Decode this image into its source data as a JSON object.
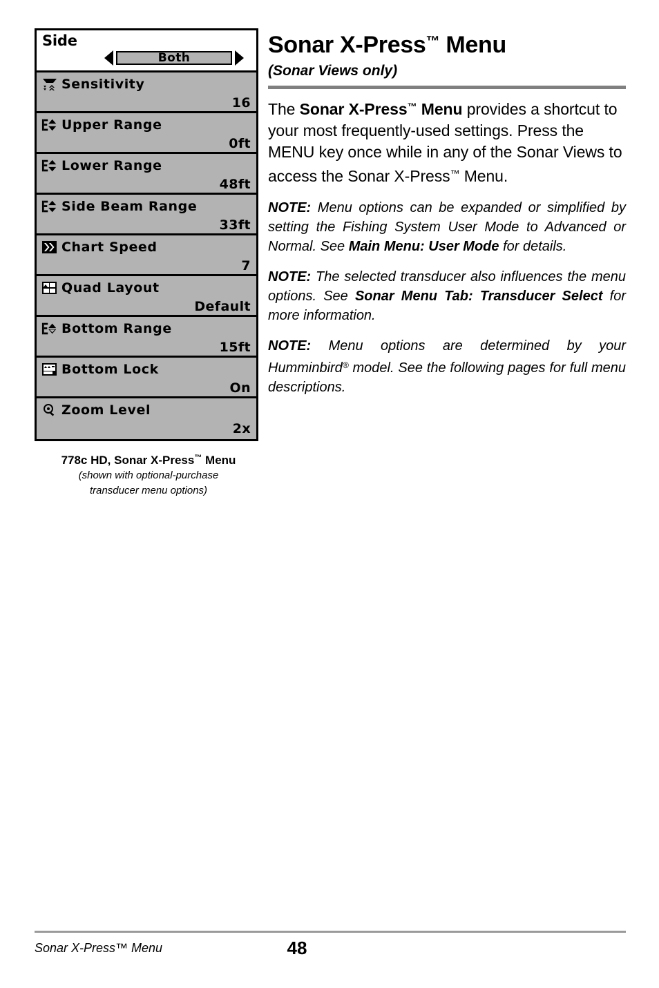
{
  "document": {
    "page_number": "48",
    "footer_left": "Sonar X-Press™ Menu"
  },
  "figure": {
    "device_menu": {
      "header": {
        "title": "Side",
        "selected_value": "Both",
        "left_arrow": "◀",
        "right_arrow": "▶"
      },
      "rows": [
        {
          "icon": "sensitivity-icon",
          "label": "Sensitivity",
          "value": "16"
        },
        {
          "icon": "upper-range-icon",
          "label": "Upper Range",
          "value": "0ft"
        },
        {
          "icon": "lower-range-icon",
          "label": "Lower Range",
          "value": "48ft"
        },
        {
          "icon": "side-beam-range-icon",
          "label": "Side Beam Range",
          "value": "33ft"
        },
        {
          "icon": "chart-speed-icon",
          "label": "Chart Speed",
          "value": "7"
        },
        {
          "icon": "quad-layout-icon",
          "label": "Quad Layout",
          "value": "Default"
        },
        {
          "icon": "bottom-range-icon",
          "label": "Bottom Range",
          "value": "15ft"
        },
        {
          "icon": "bottom-lock-icon",
          "label": "Bottom Lock",
          "value": "On"
        },
        {
          "icon": "zoom-level-icon",
          "label": "Zoom Level",
          "value": "2x"
        }
      ]
    },
    "caption_title_pre": "778c HD, Sonar X-Press",
    "caption_title_tm": "™",
    "caption_title_post": " Menu",
    "caption_sub_line1": "(shown with optional-purchase",
    "caption_sub_line2": "transducer menu options)"
  },
  "article": {
    "title_pre": "Sonar X-Press",
    "title_tm": "™",
    "title_post": " Menu",
    "subtitle": "(Sonar Views only)",
    "intro": {
      "seg1": "The ",
      "seg2_bold": "Sonar X-Press",
      "seg2_tm": "™",
      "seg3_bold": " Menu",
      "seg4": " provides a shortcut to your most frequently-used settings. Press the MENU key once while in any of the Sonar Views to access the Sonar X-Press",
      "seg5_tm": "™",
      "seg6": " Menu."
    },
    "notes": [
      {
        "label": "NOTE:",
        "seg1": " Menu options can be expanded or simplified by setting the Fishing System User Mode to Advanced or Normal. See ",
        "bold": "Main Menu: User Mode",
        "seg2": " for details."
      },
      {
        "label": "NOTE:",
        "seg1": " The selected transducer also influences the menu options. See ",
        "bold": "Sonar Menu Tab: Transducer Select",
        "seg2": " for more information."
      },
      {
        "label": "NOTE:",
        "seg1": " Menu options are determined by your Humminbird",
        "reg": "®",
        "seg2": " model. See the following pages for full menu descriptions.",
        "bold": "",
        "plain_note": true
      }
    ]
  },
  "colors": {
    "lcd_background": "#b3b3b3",
    "lcd_header_background": "#ffffff",
    "lcd_border": "#000000",
    "rule_gray": "#808080",
    "footer_rule_gray": "#9a9a9a",
    "text": "#000000"
  }
}
